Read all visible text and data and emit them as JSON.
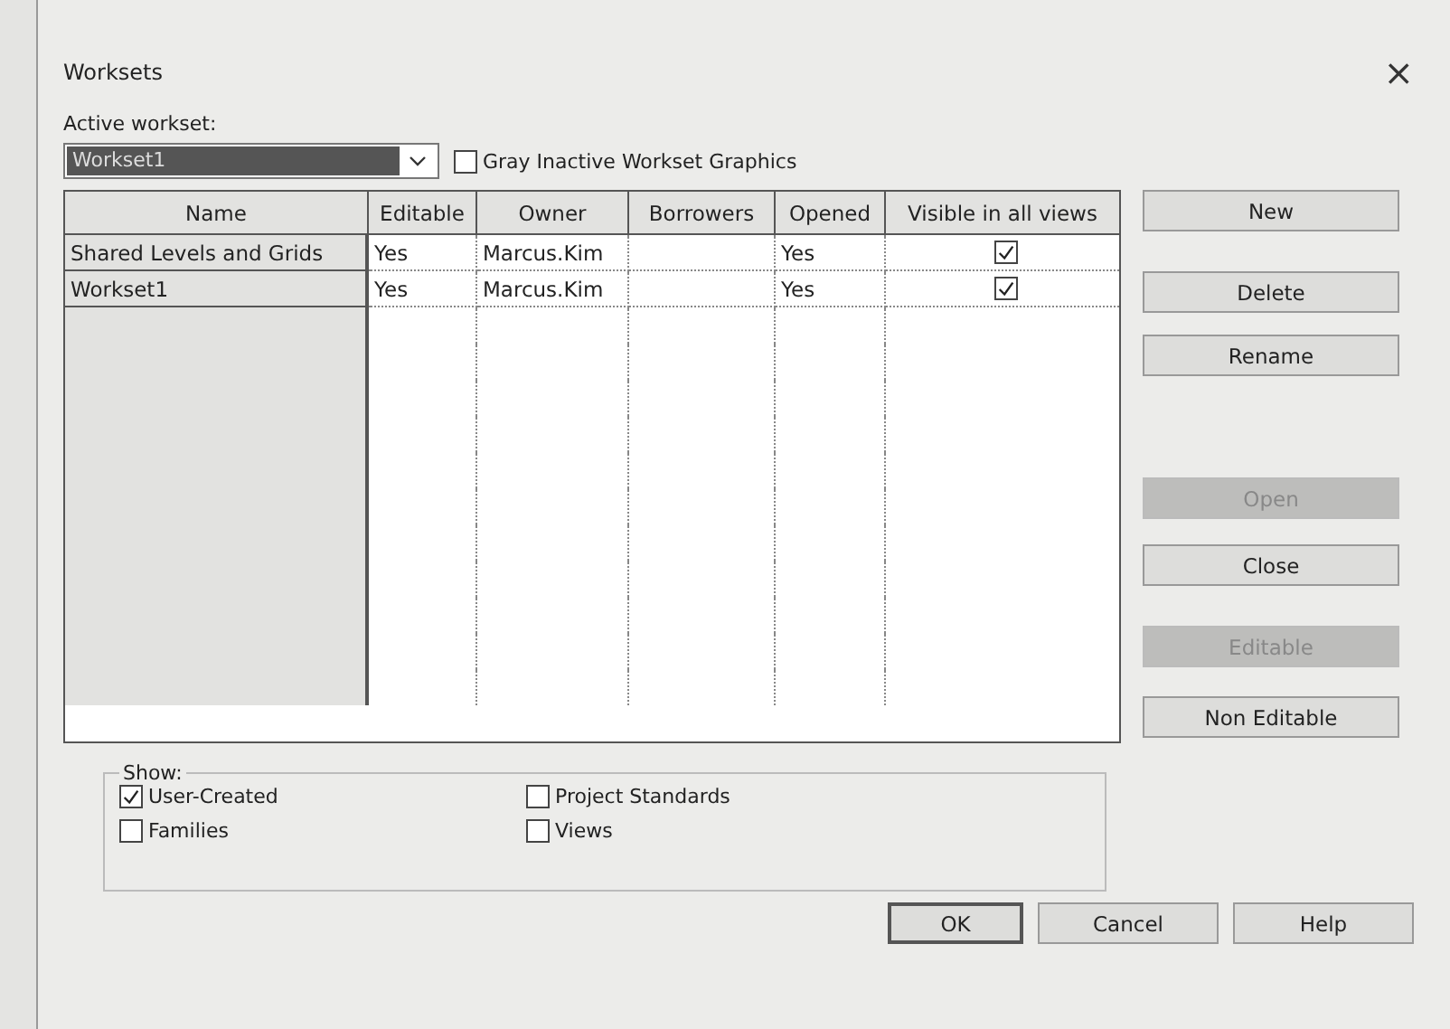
{
  "window": {
    "title": "Worksets",
    "close": "×"
  },
  "active_workset": {
    "label": "Active workset:",
    "value": "Workset1"
  },
  "gray_inactive": {
    "label": "Gray Inactive Workset Graphics",
    "checked": false
  },
  "table": {
    "columns": [
      "Name",
      "Editable",
      "Owner",
      "Borrowers",
      "Opened",
      "Visible in all views"
    ],
    "rows": [
      {
        "name": "Shared Levels and Grids",
        "editable": "Yes",
        "owner": "Marcus.Kim",
        "opened": "Yes",
        "visible": true
      },
      {
        "name": "Workset1",
        "editable": "Yes",
        "owner": "Marcus.Kim",
        "opened": "Yes",
        "visible": true
      }
    ]
  },
  "side_buttons": [
    {
      "label": "New",
      "disabled": false
    },
    {
      "label": "Delete",
      "disabled": false
    },
    {
      "label": "Rename",
      "disabled": false
    },
    {
      "label": "Open",
      "disabled": true
    },
    {
      "label": "Close",
      "disabled": false
    },
    {
      "label": "Editable",
      "disabled": true
    },
    {
      "label": "Non Editable",
      "disabled": false
    }
  ],
  "show": {
    "label": "Show:",
    "options": [
      {
        "label": "User-Created",
        "checked": true
      },
      {
        "label": "Project Standards",
        "checked": false
      },
      {
        "label": "Families",
        "checked": false
      },
      {
        "label": "Views",
        "checked": false
      }
    ]
  },
  "footer_buttons": [
    {
      "label": "OK",
      "default": true
    },
    {
      "label": "Cancel",
      "default": false
    },
    {
      "label": "Help",
      "default": false
    }
  ]
}
